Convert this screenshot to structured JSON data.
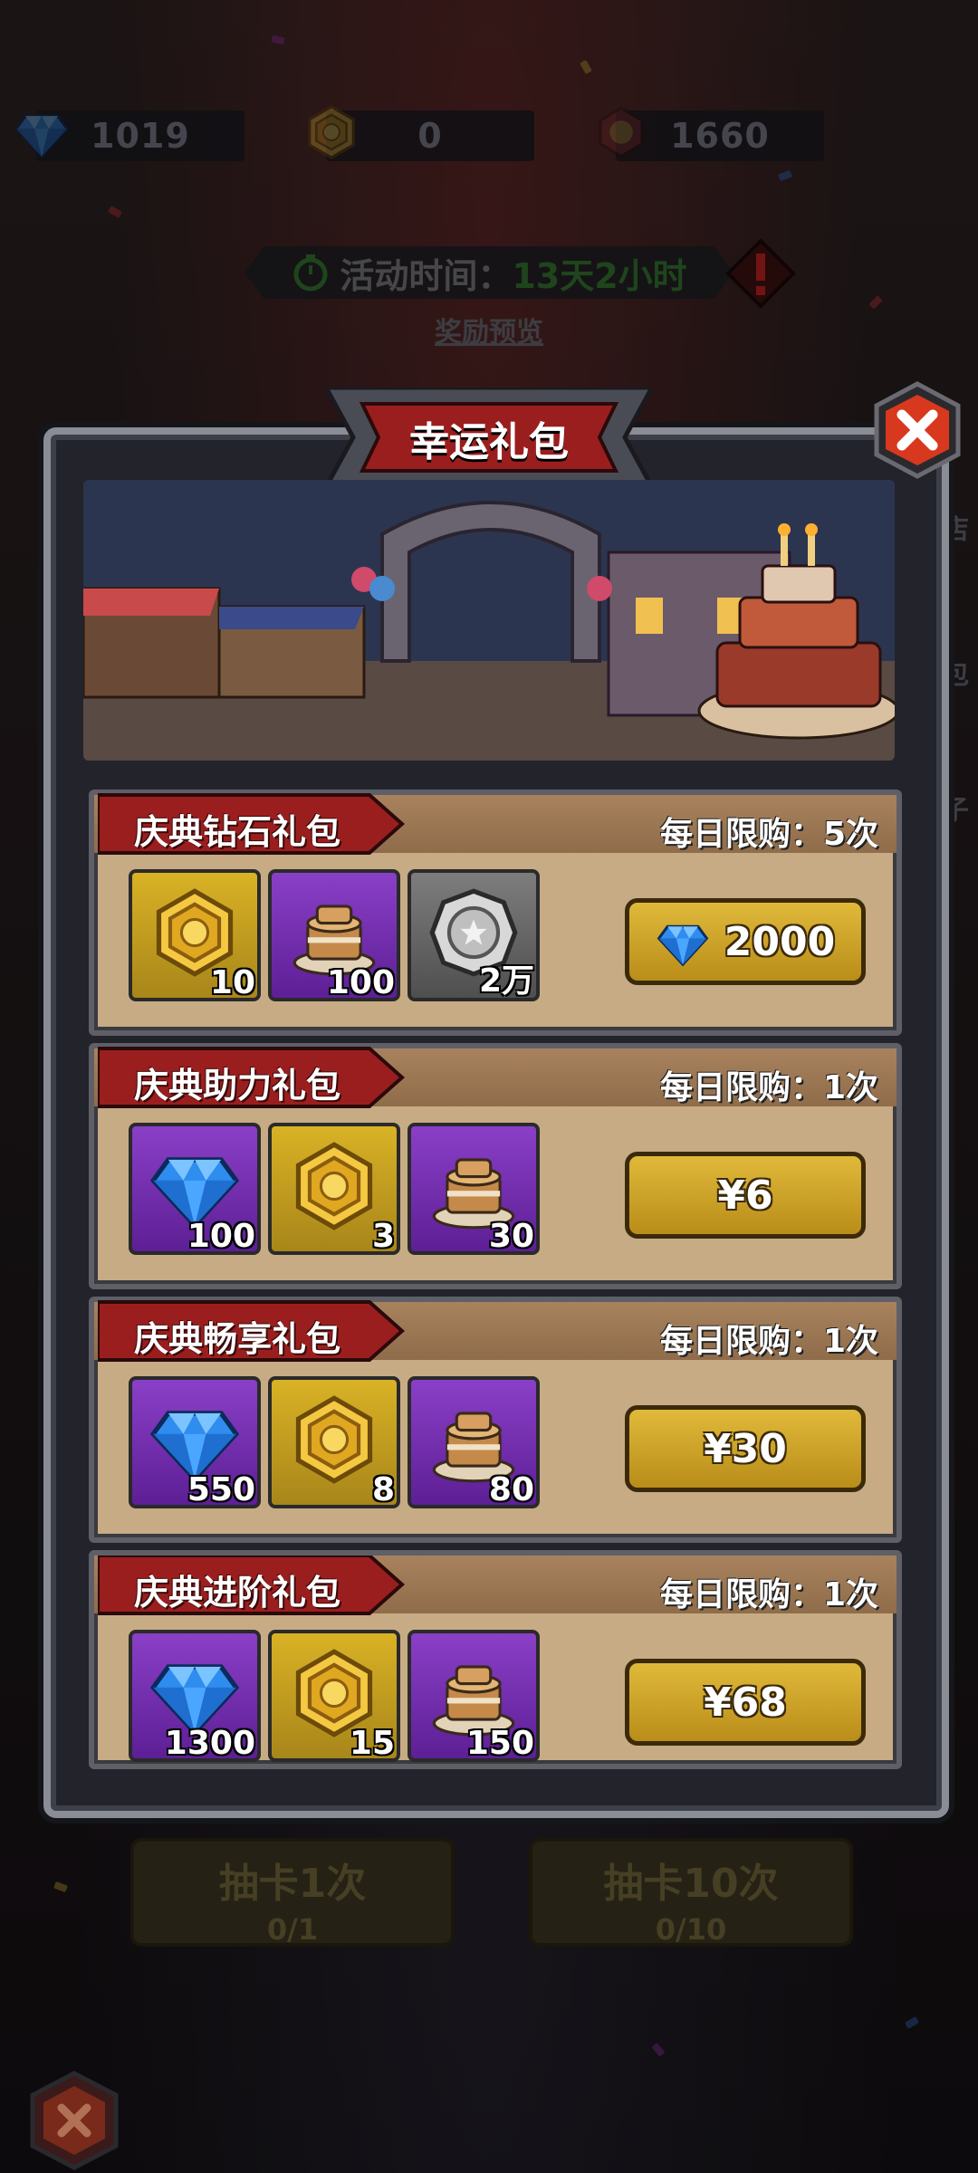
{
  "resources": [
    {
      "icon": "diamond-icon",
      "value": "1019"
    },
    {
      "icon": "coin-icon",
      "value": "0"
    },
    {
      "icon": "medal-icon",
      "value": "1660"
    }
  ],
  "event": {
    "label": "活动时间：",
    "time": "13天2小时",
    "preview": "奖励预览"
  },
  "modal": {
    "title": "幸运礼包"
  },
  "packs": [
    {
      "name": "庆典钻石礼包",
      "limit": "每日限购：5次",
      "items": [
        {
          "icon": "gold-coin-icon",
          "qty": "10",
          "style": "gold"
        },
        {
          "icon": "cake-icon",
          "qty": "100",
          "style": "purple"
        },
        {
          "icon": "silver-coin-icon",
          "qty": "2万",
          "style": "grey"
        }
      ],
      "price": "2000",
      "price_icon": "diamond-icon"
    },
    {
      "name": "庆典助力礼包",
      "limit": "每日限购：1次",
      "items": [
        {
          "icon": "diamond-icon",
          "qty": "100",
          "style": "purple"
        },
        {
          "icon": "gold-coin-icon",
          "qty": "3",
          "style": "gold"
        },
        {
          "icon": "cake-icon",
          "qty": "30",
          "style": "purple"
        }
      ],
      "price": "¥6"
    },
    {
      "name": "庆典畅享礼包",
      "limit": "每日限购：1次",
      "items": [
        {
          "icon": "diamond-icon",
          "qty": "550",
          "style": "purple"
        },
        {
          "icon": "gold-coin-icon",
          "qty": "8",
          "style": "gold"
        },
        {
          "icon": "cake-icon",
          "qty": "80",
          "style": "purple"
        }
      ],
      "price": "¥30"
    },
    {
      "name": "庆典进阶礼包",
      "limit": "每日限购：1次",
      "items": [
        {
          "icon": "diamond-icon",
          "qty": "1300",
          "style": "purple"
        },
        {
          "icon": "gold-coin-icon",
          "qty": "15",
          "style": "gold"
        },
        {
          "icon": "cake-icon",
          "qty": "150",
          "style": "purple"
        }
      ],
      "price": "¥68"
    }
  ],
  "draw_buttons": [
    {
      "label": "抽卡1次",
      "count": "0/1"
    },
    {
      "label": "抽卡10次",
      "count": "0/10"
    }
  ],
  "side_labels": [
    "店",
    "包",
    "子"
  ],
  "colors": {
    "gold_slot": "#d9b225",
    "purple_slot": "#8a3fc7",
    "grey_slot": "#7d7d7d",
    "buy_button": "#e0b93a",
    "ribbon_red": "#9b1e1e",
    "timer_green": "#2f6b2c"
  }
}
